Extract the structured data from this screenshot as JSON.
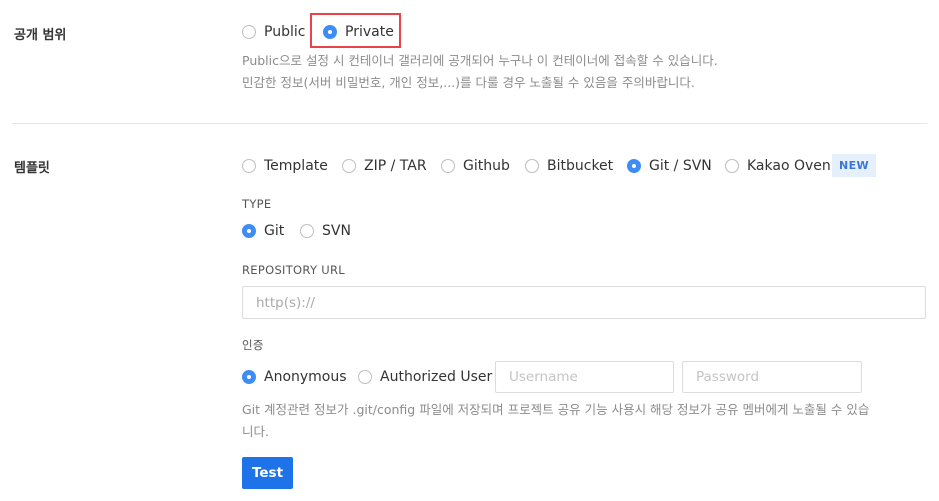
{
  "visibility": {
    "label": "공개 범위",
    "options": [
      "Public",
      "Private"
    ],
    "selected": "Private",
    "help_line1": "Public으로 설정 시 컨테이너 갤러리에 공개되어 누구나 이 컨테이너에 접속할 수 있습니다.",
    "help_line2": "민감한 정보(서버 비밀번호, 개인 정보,...)를 다룰 경우 노출될 수 있음을 주의바랍니다."
  },
  "template": {
    "label": "템플릿",
    "options": [
      "Template",
      "ZIP / TAR",
      "Github",
      "Bitbucket",
      "Git / SVN",
      "Kakao Oven"
    ],
    "selected": "Git / SVN",
    "new_badge": "NEW"
  },
  "type": {
    "label": "TYPE",
    "options": [
      "Git",
      "SVN"
    ],
    "selected": "Git"
  },
  "repository": {
    "label": "REPOSITORY URL",
    "placeholder": "http(s)://"
  },
  "auth": {
    "label": "인증",
    "options": [
      "Anonymous",
      "Authorized User"
    ],
    "selected": "Anonymous",
    "username_placeholder": "Username",
    "password_placeholder": "Password",
    "help_line1": "Git 계정관련 정보가 .git/config 파일에 저장되며 프로젝트 공유 기능 사용시 해당 정보가 공유 멤버에게 노출될 수 있습",
    "help_line2": "니다."
  },
  "test_button": "Test",
  "colors": {
    "accent": "#3f8cf5",
    "button": "#1e73e8",
    "highlight": "#e8424a",
    "badge_bg": "#e6f0fd"
  }
}
